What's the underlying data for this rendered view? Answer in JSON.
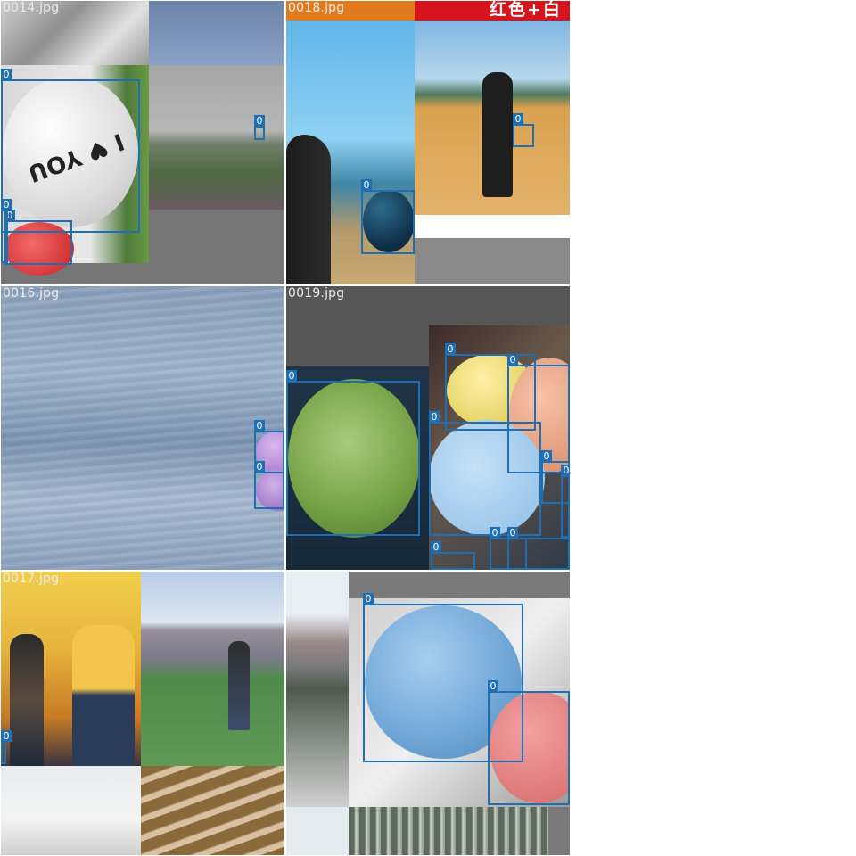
{
  "mosaic": {
    "tiles": [
      {
        "filename": "0014.jpg",
        "label": "0"
      },
      {
        "filename": "0018.jpg",
        "label": "0",
        "banner_text": "红色+白"
      },
      {
        "filename": "0016.jpg",
        "label": "0"
      },
      {
        "filename": "0019.jpg",
        "label": "0"
      },
      {
        "filename": "0017.jpg",
        "label": "0"
      },
      {
        "filename": "",
        "label": "0"
      }
    ],
    "class_label": "0",
    "balloon_text": "I ♥ YOU",
    "box_color": "#1f6fb4"
  }
}
